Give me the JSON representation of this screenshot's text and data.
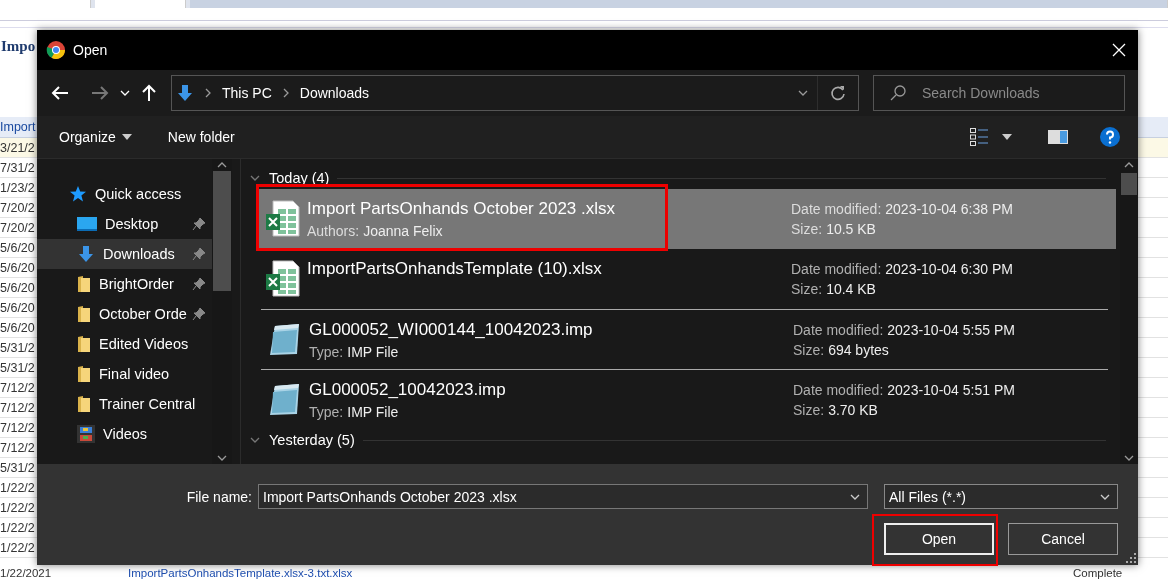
{
  "background_page": {
    "heading": "Impo",
    "column_header": "Import",
    "rows": [
      {
        "date": "3/21/2",
        "selected": true
      },
      {
        "date": "7/31/2",
        "selected": false
      },
      {
        "date": "1/23/2",
        "selected": false
      },
      {
        "date": "7/20/2",
        "selected": false
      },
      {
        "date": "7/20/2",
        "selected": false
      },
      {
        "date": "5/6/20",
        "selected": false
      },
      {
        "date": "5/6/20",
        "selected": false
      },
      {
        "date": "5/6/20",
        "selected": false
      },
      {
        "date": "5/6/20",
        "selected": false
      },
      {
        "date": "5/6/20",
        "selected": false
      },
      {
        "date": "5/31/2",
        "selected": false
      },
      {
        "date": "5/31/2",
        "selected": false
      },
      {
        "date": "7/12/2",
        "selected": false
      },
      {
        "date": "7/12/2",
        "selected": false
      },
      {
        "date": "7/12/2",
        "selected": false
      },
      {
        "date": "7/12/2",
        "selected": false
      },
      {
        "date": "5/31/2",
        "selected": false
      },
      {
        "date": "1/22/2",
        "selected": false
      },
      {
        "date": "1/22/2",
        "selected": false
      },
      {
        "date": "1/22/2",
        "selected": false
      },
      {
        "date": "1/22/2",
        "selected": false
      },
      {
        "date": "1/22/2021",
        "file": "ImportPartsOnhandsTemplate.xlsx-3.txt.xlsx",
        "status": "Complete",
        "selected": false
      }
    ]
  },
  "dialog": {
    "title": "Open",
    "address": {
      "crumbs": [
        "This PC",
        "Downloads"
      ]
    },
    "search": {
      "placeholder": "Search Downloads"
    },
    "toolbar": [
      {
        "label": "Organize",
        "dropdown": true
      },
      {
        "label": "New folder",
        "dropdown": false
      }
    ],
    "nav": [
      {
        "label": "Quick access",
        "kind": "star",
        "pinned": false,
        "selected": false,
        "children": [
          {
            "label": "Desktop",
            "kind": "desktop",
            "pinned": true,
            "selected": false
          },
          {
            "label": "Downloads",
            "kind": "download",
            "pinned": true,
            "selected": true
          },
          {
            "label": "BrightOrder",
            "kind": "folder",
            "pinned": true,
            "selected": false
          },
          {
            "label": "October Orde",
            "kind": "folder",
            "pinned": true,
            "selected": false
          },
          {
            "label": "Edited Videos",
            "kind": "folder",
            "pinned": false,
            "selected": false
          },
          {
            "label": "Final video",
            "kind": "folder",
            "pinned": false,
            "selected": false
          },
          {
            "label": "Trainer Central",
            "kind": "folder",
            "pinned": false,
            "selected": false
          },
          {
            "label": "Videos",
            "kind": "video",
            "pinned": false,
            "selected": false
          }
        ]
      }
    ],
    "groups": [
      {
        "label": "Today (4)",
        "expanded": true,
        "files": [
          {
            "name": "Import PartsOnhands October 2023 .xlsx",
            "kind": "excel",
            "detail": {
              "label": "Authors:",
              "value": "Joanna Felix"
            },
            "date": {
              "label": "Date modified:",
              "value": "2023-10-04 6:38 PM"
            },
            "size": {
              "label": "Size:",
              "value": "10.5 KB"
            },
            "selected": true,
            "highlighted": true
          },
          {
            "name": "ImportPartsOnhandsTemplate (10).xlsx",
            "kind": "excel",
            "date": {
              "label": "Date modified:",
              "value": "2023-10-04 6:30 PM"
            },
            "size": {
              "label": "Size:",
              "value": "10.4 KB"
            },
            "selected": false,
            "highlighted": false
          },
          {
            "name": "GL000052_WI000144_10042023.imp",
            "kind": "notepad",
            "detail": {
              "label": "Type:",
              "value": "IMP File"
            },
            "date": {
              "label": "Date modified:",
              "value": "2023-10-04 5:55 PM"
            },
            "size": {
              "label": "Size:",
              "value": "694 bytes"
            },
            "selected": false,
            "highlighted": false
          },
          {
            "name": "GL000052_10042023.imp",
            "kind": "notepad",
            "detail": {
              "label": "Type:",
              "value": "IMP File"
            },
            "date": {
              "label": "Date modified:",
              "value": "2023-10-04 5:51 PM"
            },
            "size": {
              "label": "Size:",
              "value": "3.70 KB"
            },
            "selected": false,
            "highlighted": false
          }
        ]
      },
      {
        "label": "Yesterday (5)",
        "expanded": true
      }
    ],
    "file_name": {
      "label": "File name:",
      "value": "Import PartsOnhands October 2023 .xlsx"
    },
    "filter": {
      "value": "All Files (*.*)"
    },
    "buttons": [
      {
        "label": "Open",
        "default": true,
        "highlighted": true
      },
      {
        "label": "Cancel",
        "default": false,
        "highlighted": false
      }
    ]
  }
}
